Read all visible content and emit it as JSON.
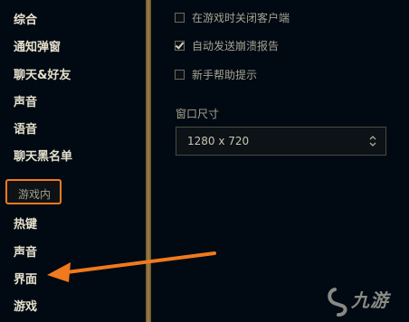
{
  "sidebar": {
    "items": [
      {
        "label": "综合",
        "active": true
      },
      {
        "label": "通知弹窗"
      },
      {
        "label": "聊天&好友"
      },
      {
        "label": "声音"
      },
      {
        "label": "语音"
      },
      {
        "label": "聊天黑名单"
      }
    ],
    "section_header": "游戏内",
    "game_items": [
      {
        "label": "热键"
      },
      {
        "label": "声音"
      },
      {
        "label": "界面"
      },
      {
        "label": "游戏"
      }
    ]
  },
  "settings": {
    "checkboxes": [
      {
        "label": "在游戏时关闭客户端",
        "checked": false
      },
      {
        "label": "自动发送崩溃报告",
        "checked": true
      },
      {
        "label": "新手帮助提示",
        "checked": false
      }
    ],
    "window_size_label": "窗口尺寸",
    "resolution_value": "1280 x 720"
  },
  "annotation": {
    "arrow_color": "#f07a1d",
    "highlight_color": "#f07a1d"
  },
  "watermark": {
    "text": "九游",
    "icon": "jiuyou-logo-icon"
  }
}
